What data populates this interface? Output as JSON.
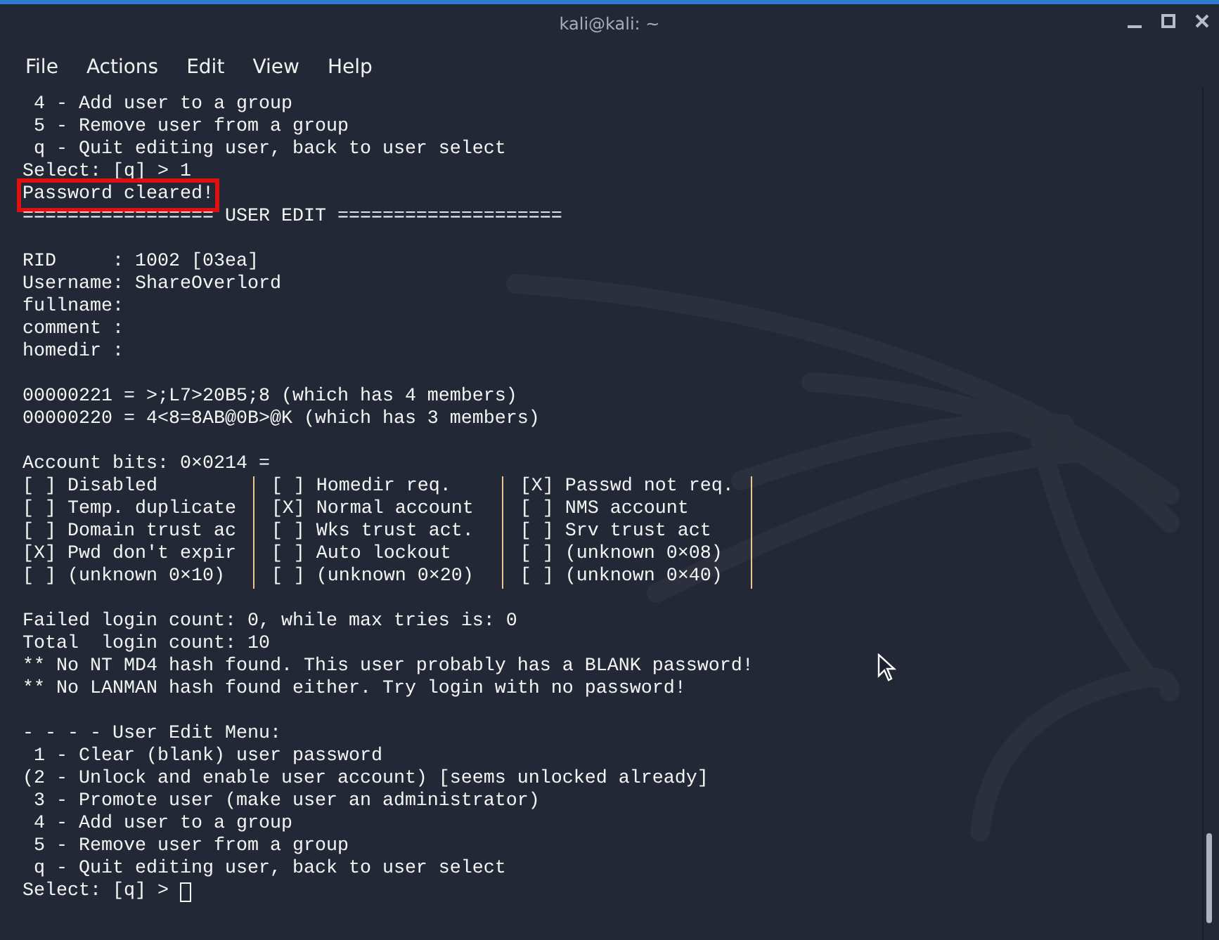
{
  "window": {
    "title": "kali@kali: ~"
  },
  "menu": [
    "File",
    "Actions",
    "Edit",
    "View",
    "Help"
  ],
  "lines": [
    {
      "kind": "text",
      "text": " 4 - Add user to a group"
    },
    {
      "kind": "text",
      "text": " 5 - Remove user from a group"
    },
    {
      "kind": "text",
      "text": " q - Quit editing user, back to user select"
    },
    {
      "kind": "text",
      "text": "Select: [q] > 1"
    },
    {
      "kind": "text",
      "text": "Password cleared!",
      "highlighted": true
    },
    {
      "kind": "text",
      "text": "================= USER EDIT ===================="
    },
    {
      "kind": "blank"
    },
    {
      "kind": "text",
      "text": "RID     : 1002 [03ea]"
    },
    {
      "kind": "text",
      "text": "Username: ShareOverlord"
    },
    {
      "kind": "text",
      "text": "fullname:"
    },
    {
      "kind": "text",
      "text": "comment :"
    },
    {
      "kind": "text",
      "text": "homedir :"
    },
    {
      "kind": "blank"
    },
    {
      "kind": "text",
      "text": "00000221 = >;L7>20B5;8 (which has 4 members)"
    },
    {
      "kind": "text",
      "text": "00000220 = 4<8=8AB@0B>@K (which has 3 members)"
    },
    {
      "kind": "blank"
    },
    {
      "kind": "text",
      "text": "Account bits: 0×0214 ="
    },
    {
      "kind": "bits",
      "cells": [
        "[ ] Disabled",
        "[ ] Homedir req.",
        "[X] Passwd not req."
      ]
    },
    {
      "kind": "bits",
      "cells": [
        "[ ] Temp. duplicate",
        "[X] Normal account",
        "[ ] NMS account"
      ]
    },
    {
      "kind": "bits",
      "cells": [
        "[ ] Domain trust ac",
        "[ ] Wks trust act.",
        "[ ] Srv trust act"
      ]
    },
    {
      "kind": "bits",
      "cells": [
        "[X] Pwd don't expir",
        "[ ] Auto lockout",
        "[ ] (unknown 0×08)"
      ]
    },
    {
      "kind": "bits",
      "cells": [
        "[ ] (unknown 0×10)",
        "[ ] (unknown 0×20)",
        "[ ] (unknown 0×40)"
      ]
    },
    {
      "kind": "blank"
    },
    {
      "kind": "text",
      "text": "Failed login count: 0, while max tries is: 0"
    },
    {
      "kind": "text",
      "text": "Total  login count: 10"
    },
    {
      "kind": "text",
      "text": "** No NT MD4 hash found. This user probably has a BLANK password!"
    },
    {
      "kind": "text",
      "text": "** No LANMAN hash found either. Try login with no password!"
    },
    {
      "kind": "blank"
    },
    {
      "kind": "text",
      "text": "- - - - User Edit Menu:"
    },
    {
      "kind": "text",
      "text": " 1 - Clear (blank) user password"
    },
    {
      "kind": "text",
      "text": "(2 - Unlock and enable user account) [seems unlocked already]"
    },
    {
      "kind": "text",
      "text": " 3 - Promote user (make user an administrator)"
    },
    {
      "kind": "text",
      "text": " 4 - Add user to a group"
    },
    {
      "kind": "text",
      "text": " 5 - Remove user from a group"
    },
    {
      "kind": "text",
      "text": " q - Quit editing user, back to user select"
    },
    {
      "kind": "prompt",
      "text": "Select: [q] > "
    }
  ]
}
